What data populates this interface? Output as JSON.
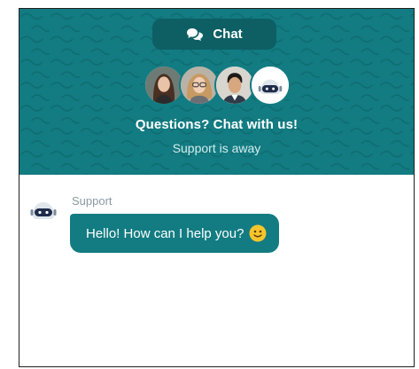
{
  "header": {
    "tab_label": "Chat",
    "tab_icon": "chat-bubbles-icon",
    "headline": "Questions? Chat with us!",
    "status": "Support is away",
    "background_color": "#127c82",
    "avatars": [
      "agent-avatar-1",
      "agent-avatar-2",
      "agent-avatar-3",
      "bot-avatar"
    ]
  },
  "conversation": {
    "messages": [
      {
        "sender": "Support",
        "text": "Hello! How can I help you?",
        "emoji": "slightly-smiling-face-icon"
      }
    ]
  }
}
